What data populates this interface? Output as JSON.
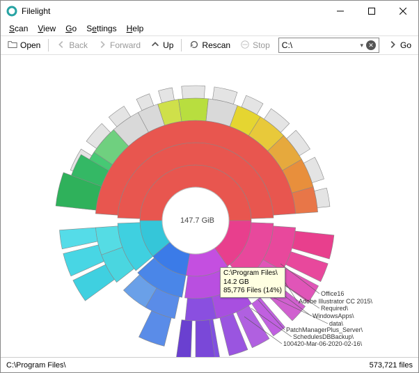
{
  "app": {
    "title": "Filelight"
  },
  "menu": {
    "scan": "Scan",
    "view": "View",
    "go": "Go",
    "settings": "Settings",
    "help": "Help"
  },
  "toolbar": {
    "open": "Open",
    "back": "Back",
    "forward": "Forward",
    "up": "Up",
    "rescan": "Rescan",
    "stop": "Stop",
    "go": "Go",
    "path": "C:\\"
  },
  "center": {
    "size": "147.7 GiB"
  },
  "tooltip": {
    "path": "C:\\Program Files\\",
    "size": "14.2 GB",
    "files": "85,776 Files (14%)"
  },
  "annotations": {
    "a0": "Office16",
    "a1": "Adobe Illustrator CC 2015\\",
    "a2": "Required\\",
    "a3": "WindowsApps\\",
    "a4": "data\\",
    "a5": "PatchManagerPlus_Server\\",
    "a6": "SchedulesDBBackup\\",
    "a7": "100420-Mar-06-2020-02-16\\"
  },
  "status": {
    "path": "C:\\Program Files\\",
    "files": "573,721 files"
  },
  "chart_data": {
    "type": "sunburst",
    "root": {
      "path": "C:\\",
      "size_gib": 147.7
    },
    "highlighted": {
      "path": "C:\\Program Files\\",
      "size_gb": 14.2,
      "file_count": 85776,
      "percent": 14
    },
    "labeled_descendants": [
      "Office16",
      "Adobe Illustrator CC 2015\\",
      "Required\\",
      "WindowsApps\\",
      "data\\",
      "PatchManagerPlus_Server\\",
      "SchedulesDBBackup\\",
      "100420-Mar-06-2020-02-16\\"
    ]
  }
}
